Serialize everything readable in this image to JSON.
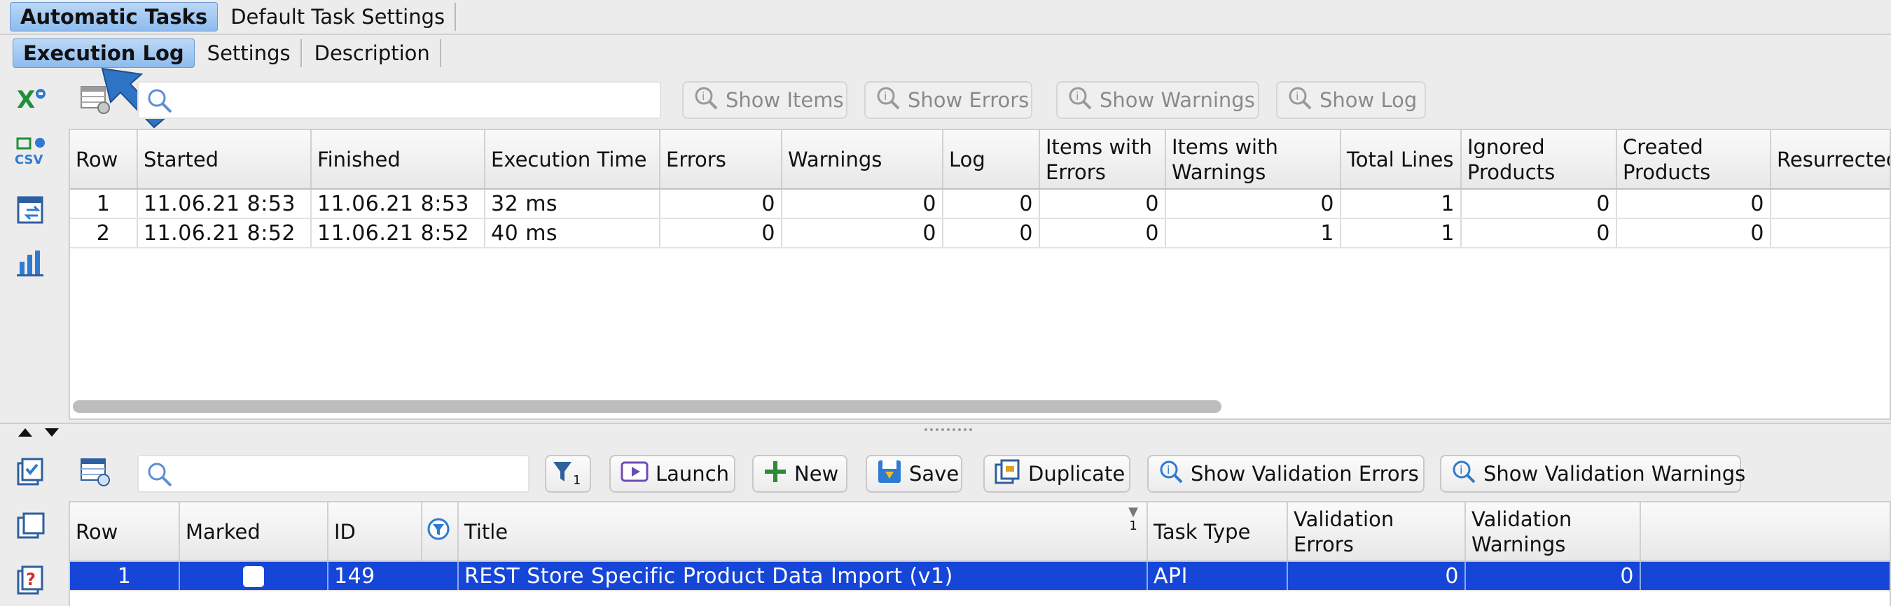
{
  "top_tabs": [
    {
      "label": "Automatic Tasks",
      "active": true
    },
    {
      "label": "Default Task Settings",
      "active": false
    }
  ],
  "sub_tabs": [
    {
      "label": "Execution Log",
      "active": true
    },
    {
      "label": "Settings",
      "active": false
    },
    {
      "label": "Description",
      "active": false
    }
  ],
  "log_toolbar": {
    "search_value": "",
    "show_items": "Show Items",
    "show_errors": "Show Errors",
    "show_warnings": "Show Warnings",
    "show_log": "Show Log"
  },
  "log_table": {
    "columns": [
      "Row",
      "Started",
      "Finished",
      "Execution Time",
      "Errors",
      "Warnings",
      "Log",
      "Items with Errors",
      "Items with Warnings",
      "Total Lines",
      "Ignored Products",
      "Created Products",
      "Resurrected Products"
    ],
    "rows": [
      [
        "1",
        "11.06.21 8:53",
        "11.06.21 8:53",
        "32 ms",
        "0",
        "0",
        "0",
        "0",
        "0",
        "1",
        "0",
        "0",
        ""
      ],
      [
        "2",
        "11.06.21 8:52",
        "11.06.21 8:52",
        "40 ms",
        "0",
        "0",
        "0",
        "0",
        "1",
        "1",
        "0",
        "0",
        ""
      ]
    ]
  },
  "task_toolbar": {
    "search_value": "",
    "filter_badge": "1",
    "launch": "Launch",
    "new": "New",
    "save": "Save",
    "duplicate": "Duplicate",
    "show_validation_errors": "Show Validation Errors",
    "show_validation_warnings": "Show Validation Warnings"
  },
  "task_table": {
    "columns": [
      "Row",
      "Marked",
      "ID",
      "Title",
      "Task Type",
      "Validation Errors",
      "Validation Warnings"
    ],
    "title_sort_index": "1",
    "rows": [
      [
        "1",
        "",
        "149",
        "REST Store Specific Product Data Import (v1)",
        "API",
        "0",
        "0"
      ]
    ]
  },
  "colors": {
    "accent_blue": "#1646d8",
    "active_tab": "#8dbbef",
    "arrow": "#2f73c4"
  }
}
